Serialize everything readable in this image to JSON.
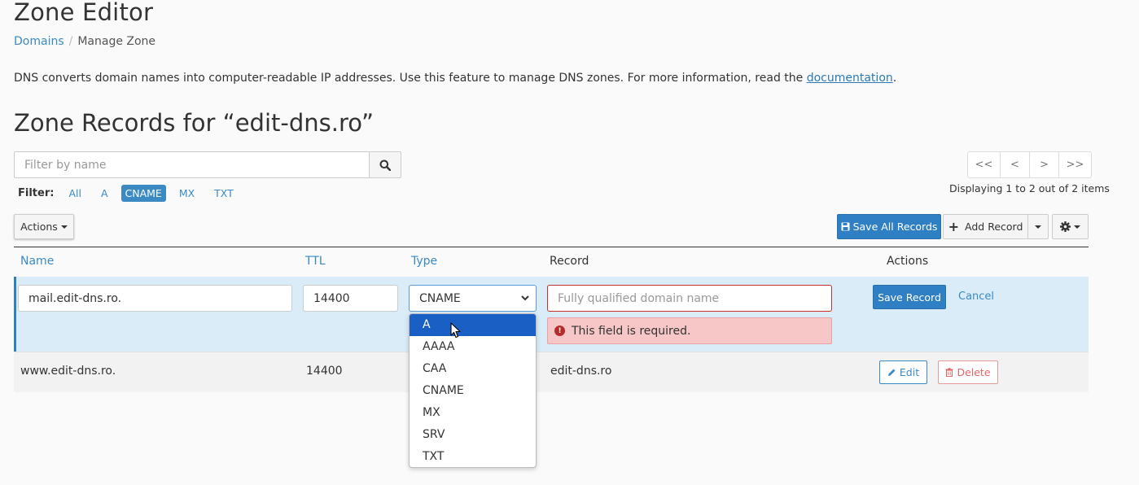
{
  "page": {
    "title": "Zone Editor",
    "breadcrumb": {
      "link": "Domains",
      "separator": "/",
      "current": "Manage Zone"
    },
    "description_prefix": "DNS converts domain names into computer-readable IP addresses. Use this feature to manage DNS zones. For more information, read the ",
    "description_link": "documentation",
    "description_suffix": ".",
    "section_title": "Zone Records for “edit-dns.ro”"
  },
  "filter": {
    "placeholder": "Filter by name",
    "label": "Filter:",
    "chips": [
      "All",
      "A",
      "CNAME",
      "MX",
      "TXT"
    ],
    "active_chip": "CNAME"
  },
  "pagination": {
    "first": "<<",
    "prev": "<",
    "next": ">",
    "last": ">>",
    "info": "Displaying 1 to 2 out of 2 items"
  },
  "toolbar": {
    "actions_label": "Actions",
    "save_all_label": "Save All Records",
    "add_record_label": "Add Record"
  },
  "table": {
    "headers": {
      "name": "Name",
      "ttl": "TTL",
      "type": "Type",
      "record": "Record",
      "actions": "Actions"
    },
    "edit_row": {
      "name": "mail.edit-dns.ro.",
      "ttl": "14400",
      "type": "CNAME",
      "record_placeholder": "Fully qualified domain name",
      "error": "This field is required.",
      "save_label": "Save Record",
      "cancel_label": "Cancel"
    },
    "row2": {
      "name": "www.edit-dns.ro.",
      "ttl": "14400",
      "record": "edit-dns.ro",
      "edit_label": "Edit",
      "delete_label": "Delete"
    }
  },
  "type_dropdown": {
    "options": [
      "A",
      "AAAA",
      "CAA",
      "CNAME",
      "MX",
      "SRV",
      "TXT"
    ],
    "highlighted": "A"
  },
  "colors": {
    "accent": "#2f7fc4",
    "link": "#3b8ac4",
    "edit_row_bg": "#d9ecf7",
    "error_bg": "#f7c6c6",
    "error_border": "#c9302c"
  }
}
